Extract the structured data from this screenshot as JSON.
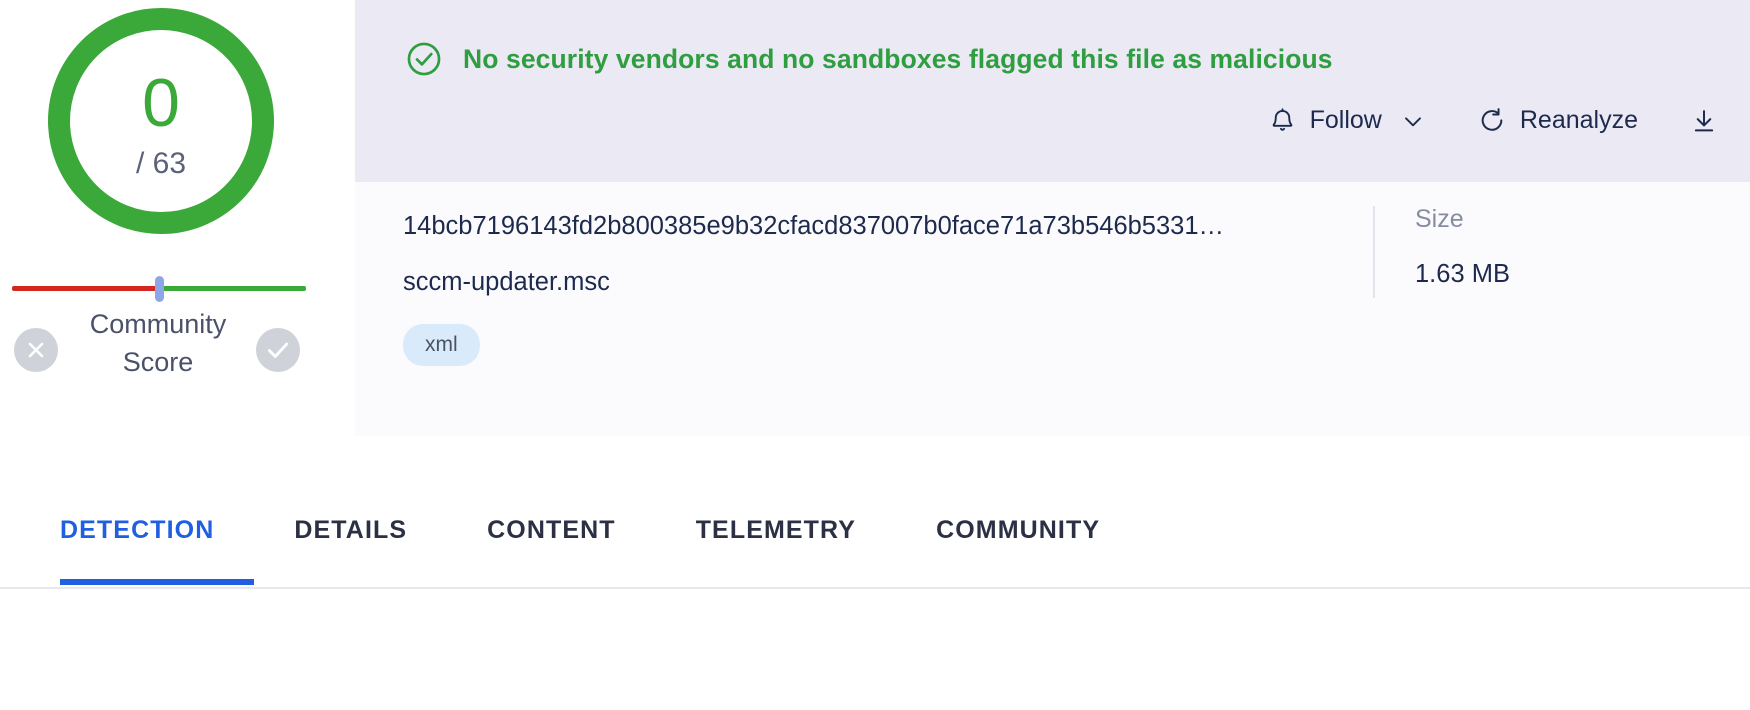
{
  "score": {
    "detections": "0",
    "total": "/ 63",
    "ring_color": "#3aa93a",
    "community_label": "Community\nScore",
    "community_label_line1": "Community",
    "community_label_line2": "Score",
    "vote_down_icon": "x-circle-icon",
    "vote_up_icon": "check-circle-icon",
    "slider_negative_color": "#d4271d",
    "slider_positive_color": "#3aa93a",
    "slider_handle_color": "#8ea6e8"
  },
  "verdict": {
    "icon": "check-circle-outline-icon",
    "message": "No security vendors and no sandboxes flagged this file as malicious",
    "color": "#2f9e41",
    "band_color": "#ebeaf4"
  },
  "actions": [
    {
      "label": "Follow",
      "icon": "bell-icon",
      "has_chevron": true
    },
    {
      "label": "Reanalyze",
      "icon": "refresh-icon",
      "has_chevron": false
    },
    {
      "label": "",
      "icon": "download-icon",
      "has_chevron": false
    }
  ],
  "file": {
    "hash": "14bcb7196143fd2b800385e9b32cfacd837007b0face71a73b546b5331…",
    "name": "sccm-updater.msc",
    "tag": "xml",
    "size_label": "Size",
    "size_value": "1.63 MB"
  },
  "tabs": [
    {
      "label": "DETECTION",
      "active": true
    },
    {
      "label": "DETAILS",
      "active": false
    },
    {
      "label": "CONTENT",
      "active": false
    },
    {
      "label": "TELEMETRY",
      "active": false
    },
    {
      "label": "COMMUNITY",
      "active": false
    }
  ]
}
